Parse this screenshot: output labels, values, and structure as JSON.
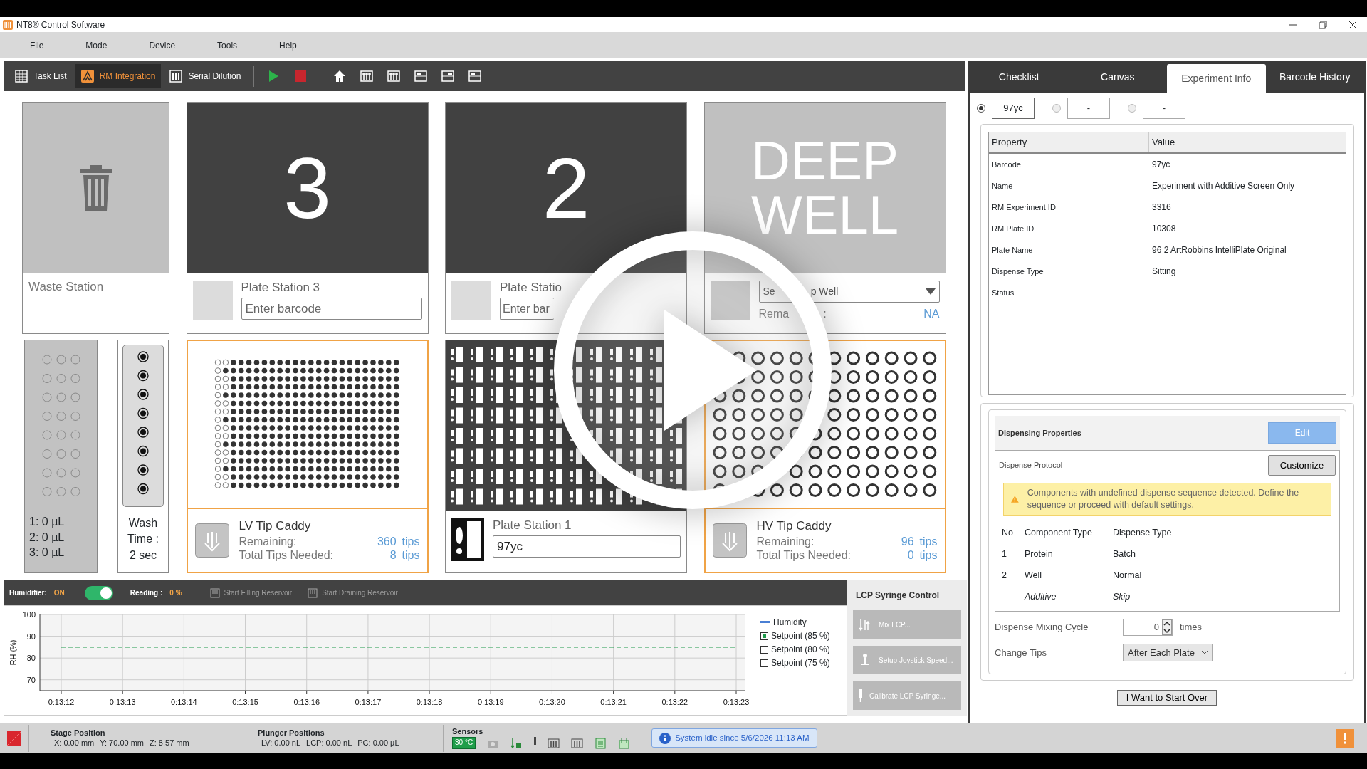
{
  "window": {
    "title": "NT8® Control Software"
  },
  "menu": [
    "File",
    "Mode",
    "Device",
    "Tools",
    "Help"
  ],
  "toolbar": [
    {
      "label": "Task List",
      "selected": false
    },
    {
      "label": "RM Integration",
      "selected": true
    },
    {
      "label": "Serial Dilution",
      "selected": false
    }
  ],
  "stations": {
    "waste": {
      "label": "Waste Station"
    },
    "plate_station_3": {
      "number": "3",
      "title": "Plate Station 3",
      "barcode_placeholder": "Enter barcode"
    },
    "plate_station_2": {
      "number": "2",
      "title": "Plate Statio",
      "barcode_placeholder": "Enter bar"
    },
    "deep_well": {
      "heading": [
        "DEEP",
        "WELL"
      ],
      "select_parts": [
        "Se",
        "p Well"
      ],
      "remaining_parts": [
        "Rema",
        ":"
      ],
      "remaining": "NA"
    },
    "reservoir": {
      "readings": [
        "1: 0 µL",
        "2: 0 µL",
        "3: 0 µL"
      ]
    },
    "wash": {
      "lines": [
        "Wash",
        "Time :",
        "2 sec"
      ]
    },
    "lv_tip_caddy": {
      "title": "LV Tip Caddy",
      "remaining_label": "Remaining:",
      "remaining": "360",
      "remaining_unit": "tips",
      "needed_label": "Total Tips Needed:",
      "needed": "8",
      "needed_unit": "tips"
    },
    "plate_station_1": {
      "title": "Plate Station 1",
      "barcode": "97yc"
    },
    "hv_tip_caddy": {
      "title": "HV Tip Caddy",
      "remaining_label": "Remaining:",
      "remaining": "96",
      "remaining_unit": "tips",
      "needed_label": "Total Tips Needed:",
      "needed": "0",
      "needed_unit": "tips"
    }
  },
  "humidifier": {
    "label": "Humidifier:",
    "state": "ON",
    "on": true,
    "reading_label": "Reading :",
    "reading": "0 %",
    "actions": [
      {
        "label": "Start Filling Reservoir",
        "disabled": true
      },
      {
        "label": "Start Draining Reservoir",
        "disabled": true
      }
    ],
    "chart_data": {
      "type": "line",
      "ylabel": "RH (%)",
      "categories": [
        "0:13:12",
        "0:13:13",
        "0:13:14",
        "0:13:15",
        "0:13:16",
        "0:13:17",
        "0:13:18",
        "0:13:19",
        "0:13:20",
        "0:13:21",
        "0:13:22",
        "0:13:23"
      ],
      "ylim": [
        65,
        100
      ],
      "yticks": [
        70,
        80,
        90,
        100
      ],
      "grid": true,
      "series": [
        {
          "name": "Setpoint (85 %)",
          "color": "#1e9a4a",
          "line_style": "dashed",
          "values": [
            85,
            85,
            85,
            85,
            85,
            85,
            85,
            85,
            85,
            85,
            85,
            85
          ]
        }
      ]
    },
    "legend": [
      {
        "label": "Humidity",
        "kind": "line",
        "color": "#4a7fd4"
      },
      {
        "kind": "series",
        "checked": true
      },
      {
        "label": "Setpoint (80 %)",
        "kind": "checkbox",
        "checked": false
      },
      {
        "label": "Setpoint (75 %)",
        "kind": "checkbox",
        "checked": false
      }
    ]
  },
  "lcp_syringe_control": {
    "title": "LCP Syringe Control",
    "buttons": [
      "Mix LCP...",
      "Setup Joystick Speed...",
      "Calibrate LCP Syringe..."
    ]
  },
  "right_panel": {
    "tabs": [
      {
        "label": "Checklist",
        "selected": false
      },
      {
        "label": "Canvas",
        "selected": false
      },
      {
        "label": "Experiment Info",
        "selected": true
      },
      {
        "label": "Barcode History",
        "selected": false
      }
    ],
    "plates": [
      {
        "value": "97yc",
        "selected": true
      },
      {
        "value": "-",
        "selected": false
      },
      {
        "value": "-",
        "selected": false
      }
    ],
    "properties": {
      "columns": [
        "Property",
        "Value"
      ],
      "rows": [
        {
          "property": "Barcode",
          "value": "97yc"
        },
        {
          "property": "Name",
          "value": "Experiment with Additive Screen Only"
        },
        {
          "property": "RM Experiment ID",
          "value": "3316"
        },
        {
          "property": "RM Plate ID",
          "value": "10308"
        },
        {
          "property": "Plate Name",
          "value": "96 2 ArtRobbins IntelliPlate Original"
        },
        {
          "property": "Dispense Type",
          "value": "Sitting"
        },
        {
          "property": "Status"
        }
      ]
    },
    "dispensing": {
      "title": "Dispensing Properties",
      "edit": {
        "label": "Edit",
        "disabled": true
      },
      "protocol_label": "Dispense Protocol",
      "customize": "Customize",
      "warning": "Components with undefined dispense sequence detected. Define the sequence or proceed with default settings.",
      "columns": [
        "No",
        "Component Type",
        "Dispense Type"
      ],
      "rows": [
        {
          "no": "1",
          "component": "Protein",
          "dispense": "Batch",
          "skipped": false
        },
        {
          "no": "2",
          "component": "Well",
          "dispense": "Normal",
          "skipped": false
        },
        {
          "component": "Additive",
          "dispense": "Skip",
          "skipped": true
        }
      ],
      "mixing_label": "Dispense Mixing Cycle",
      "mixing_value": "0",
      "mixing_unit": "times",
      "tips_label": "Change Tips",
      "tips_value": "After Each Plate"
    },
    "start_over": "I Want to Start Over"
  },
  "status_bar": {
    "stage": {
      "title": "Stage Position",
      "values": [
        "X: 0.00 mm",
        "Y: 70.00 mm",
        "Z: 8.57 mm"
      ]
    },
    "plunger": {
      "title": "Plunger Positions",
      "values": [
        "LV: 0.00 nL",
        "LCP: 0.00 nL",
        "PC: 0.00 µL"
      ]
    },
    "sensors": {
      "title": "Sensors",
      "temperature": "30 °C"
    },
    "message": "System idle since 5/6/2026 11:13 AM"
  }
}
